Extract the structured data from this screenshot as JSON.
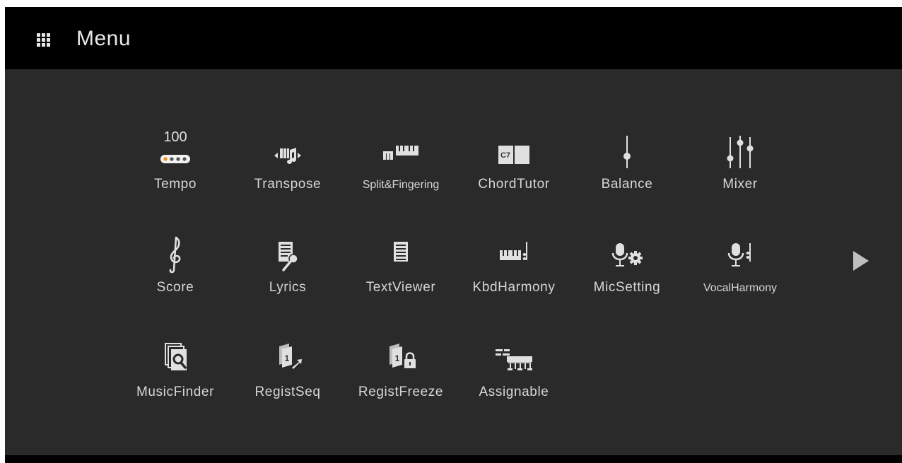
{
  "header": {
    "title": "Menu",
    "icon": "menu-grid-icon"
  },
  "tempo": {
    "value": "100"
  },
  "items": [
    {
      "label": "Tempo",
      "icon": "tempo-icon"
    },
    {
      "label": "Transpose",
      "icon": "transpose-icon"
    },
    {
      "label": "Split&Fingering",
      "icon": "split-fingering-icon"
    },
    {
      "label": "ChordTutor",
      "icon": "chord-tutor-icon"
    },
    {
      "label": "Balance",
      "icon": "balance-icon"
    },
    {
      "label": "Mixer",
      "icon": "mixer-icon"
    },
    {
      "label": "Score",
      "icon": "score-icon"
    },
    {
      "label": "Lyrics",
      "icon": "lyrics-icon"
    },
    {
      "label": "TextViewer",
      "icon": "text-viewer-icon"
    },
    {
      "label": "KbdHarmony",
      "icon": "kbd-harmony-icon"
    },
    {
      "label": "MicSetting",
      "icon": "mic-setting-icon"
    },
    {
      "label": "VocalHarmony",
      "icon": "vocal-harmony-icon"
    },
    {
      "label": "MusicFinder",
      "icon": "music-finder-icon"
    },
    {
      "label": "RegistSeq",
      "icon": "regist-seq-icon"
    },
    {
      "label": "RegistFreeze",
      "icon": "regist-freeze-icon"
    },
    {
      "label": "Assignable",
      "icon": "assignable-icon"
    }
  ],
  "chord_tutor_icon_text": "C7",
  "regist_icon_text": "1",
  "page_nav": {
    "icon": "next-page-arrow-icon"
  },
  "colors": {
    "background": "#2a2a2a",
    "titlebar": "#000000",
    "label": "#d6d6d6",
    "icon": "#e0e0e0",
    "accent": "#ff8a00"
  }
}
